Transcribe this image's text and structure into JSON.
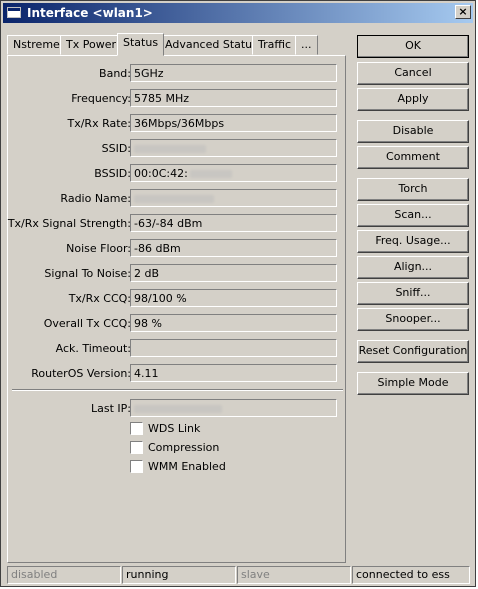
{
  "window": {
    "title": "Interface <wlan1>",
    "close_glyph": "×"
  },
  "tabs": [
    {
      "label": "Nstreme"
    },
    {
      "label": "Tx Power"
    },
    {
      "label": "Status",
      "active": true
    },
    {
      "label": "Advanced Status"
    },
    {
      "label": "Traffic"
    },
    {
      "label": "..."
    }
  ],
  "fields": {
    "band": {
      "label": "Band:",
      "value": "5GHz"
    },
    "frequency": {
      "label": "Frequency:",
      "value": "5785 MHz"
    },
    "txrx_rate": {
      "label": "Tx/Rx Rate:",
      "value": "36Mbps/36Mbps"
    },
    "ssid": {
      "label": "SSID:",
      "value": ""
    },
    "bssid": {
      "label": "BSSID:",
      "value": "00:0C:42:"
    },
    "radio_name": {
      "label": "Radio Name:",
      "value": ""
    },
    "signal_strength": {
      "label": "Tx/Rx Signal Strength:",
      "value": "-63/-84 dBm"
    },
    "noise_floor": {
      "label": "Noise Floor:",
      "value": "-86 dBm"
    },
    "signal_to_noise": {
      "label": "Signal To Noise:",
      "value": "2 dB"
    },
    "txrx_ccq": {
      "label": "Tx/Rx CCQ:",
      "value": "98/100 %"
    },
    "overall_tx_ccq": {
      "label": "Overall Tx CCQ:",
      "value": "98 %"
    },
    "ack_timeout": {
      "label": "Ack. Timeout:",
      "value": ""
    },
    "routeros_version": {
      "label": "RouterOS Version:",
      "value": "4.11"
    },
    "last_ip": {
      "label": "Last IP:",
      "value": ""
    }
  },
  "checkboxes": {
    "wds_link": {
      "label": "WDS Link",
      "checked": false
    },
    "compression": {
      "label": "Compression",
      "checked": false
    },
    "wmm_enabled": {
      "label": "WMM Enabled",
      "checked": false
    }
  },
  "buttons": {
    "ok": "OK",
    "cancel": "Cancel",
    "apply": "Apply",
    "disable": "Disable",
    "comment": "Comment",
    "torch": "Torch",
    "scan": "Scan...",
    "freq_usage": "Freq. Usage...",
    "align": "Align...",
    "sniff": "Sniff...",
    "snooper": "Snooper...",
    "reset_configuration": "Reset Configuration",
    "simple_mode": "Simple Mode"
  },
  "statusbar": {
    "state": "disabled",
    "running": "running",
    "role": "slave",
    "connection": "connected to ess"
  },
  "colors": {
    "titlebar_start": "#0a246a",
    "titlebar_end": "#a6caf0",
    "window_bg": "#d4d0c8"
  }
}
